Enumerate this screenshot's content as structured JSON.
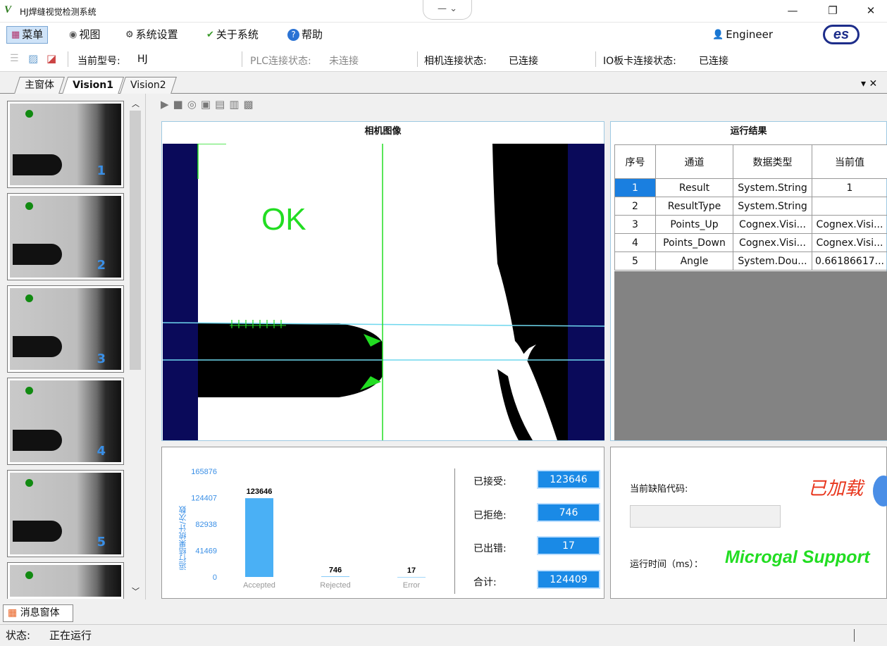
{
  "window": {
    "logo": "V",
    "title": "HJ焊缝视觉检测系统",
    "dropdown": "—  ⌄",
    "min": "—",
    "max": "❐",
    "close": "✕"
  },
  "menu": {
    "items": [
      "菜单",
      "视图",
      "系统设置",
      "关于系统",
      "帮助"
    ],
    "user": "Engineer",
    "brand": "es"
  },
  "strip": {
    "model_label": "当前型号:",
    "model_value": "HJ",
    "plc_label": "PLC连接状态:",
    "plc_value": "未连接",
    "cam_label": "相机连接状态:",
    "cam_value": "已连接",
    "io_label": "IO板卡连接状态:",
    "io_value": "已连接"
  },
  "tabs": [
    "主窗体",
    "Vision1",
    "Vision2"
  ],
  "tabs_close": "▾ ✕",
  "thumbnails": [
    "1",
    "2",
    "3",
    "4",
    "5",
    ""
  ],
  "camera": {
    "title": "相机图像",
    "ok_text": "OK"
  },
  "results": {
    "title": "运行结果",
    "headers": [
      "序号",
      "通道",
      "数据类型",
      "当前值"
    ],
    "rows": [
      [
        "1",
        "Result",
        "System.String",
        "1"
      ],
      [
        "2",
        "ResultType",
        "System.String",
        ""
      ],
      [
        "3",
        "Points_Up",
        "Cognex.Visi...",
        "Cognex.Visi..."
      ],
      [
        "4",
        "Points_Down",
        "Cognex.Visi...",
        "Cognex.Visi..."
      ],
      [
        "5",
        "Angle",
        "System.Dou...",
        "0.66186617..."
      ]
    ]
  },
  "stats": {
    "ylabel": "运行结果统计/次数",
    "yticks": [
      "165876",
      "124407",
      "82938",
      "41469",
      "0"
    ],
    "accepted_label": "已接受:",
    "accepted": "123646",
    "rejected_label": "已拒绝:",
    "rejected": "746",
    "error_label": "已出错:",
    "error": "17",
    "total_label": "合计:",
    "total": "124409"
  },
  "chart_data": {
    "type": "bar",
    "categories": [
      "Accepted",
      "Rejected",
      "Error"
    ],
    "values": [
      123646,
      746,
      17
    ],
    "ylabel": "运行结果统计/次数",
    "ylim": [
      0,
      165876
    ]
  },
  "defect": {
    "code_label": "当前缺陷代码:",
    "loaded": "已加载",
    "time_label": "运行时间（ms）：",
    "support": "Microgal Support"
  },
  "bottom": {
    "msg_tab": "消息窗体",
    "status_label": "状态:",
    "status_value": "正在运行"
  },
  "colors": {
    "accent": "#1a8ae6",
    "ok_green": "#22dd22",
    "overlay_cyan": "#6ed7ee",
    "navy": "#0a0a5a"
  }
}
